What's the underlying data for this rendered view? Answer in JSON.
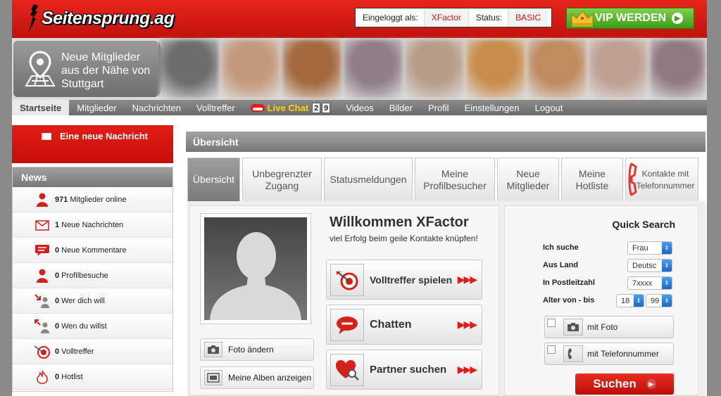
{
  "header": {
    "logo_text": "Seitensprung.ag",
    "logged_in_label": "Eingeloggt als:",
    "username": "XFactor",
    "status_label": "Status:",
    "status_value": "BASIC",
    "vip_button": "VIP WERDEN",
    "vip_arrow": "▶"
  },
  "banner": {
    "nearby_text": "Neue Mitglieder aus der Nähe von Stuttgart",
    "thumbs": [
      "#6d6d6d",
      "#c49a7e",
      "#a4693d",
      "#8f7d88",
      "#b89d89",
      "#c98c4b",
      "#c08b5e",
      "#bfa091",
      "#8e7a7f"
    ]
  },
  "nav": {
    "items": [
      "Startseite",
      "Mitglieder",
      "Nachrichten",
      "Volltreffer"
    ],
    "live_chat": "Live Chat",
    "live_digits": [
      "2",
      "9"
    ],
    "items_after": [
      "Videos",
      "Bilder",
      "Profil",
      "Einstellungen",
      "Logout"
    ]
  },
  "sidebar": {
    "new_message": "Eine neue Nachricht",
    "news_title": "News",
    "news": [
      {
        "count": "971",
        "label": "Mitglieder online"
      },
      {
        "count": "1",
        "label": "Neue Nachrichten"
      },
      {
        "count": "0",
        "label": "Neue Kommentare"
      },
      {
        "count": "0",
        "label": "Profilbesuche"
      },
      {
        "count": "0",
        "label": "Wer dich will"
      },
      {
        "count": "0",
        "label": "Wen du willst"
      },
      {
        "count": "0",
        "label": "Volltreffer"
      },
      {
        "count": "0",
        "label": "Hotlist"
      }
    ]
  },
  "main": {
    "title": "Übersicht",
    "tabs": [
      {
        "label": "Übersicht"
      },
      {
        "label": "Unbegrenzter Zugang"
      },
      {
        "label": "Statusmeldungen"
      },
      {
        "label": "Meine Profilbesucher"
      },
      {
        "label": "Neue Mitglieder"
      },
      {
        "label": "Meine Hotliste"
      },
      {
        "label": "Kontakte mit Telefonnummer"
      }
    ],
    "welcome": "Willkommen XFactor",
    "subtitle": "viel Erfolg beim geile Kontakte knüpfen!",
    "photo_change": "Foto ändern",
    "show_albums": "Meine Alben anzeigen",
    "actions": [
      {
        "label": "Volltreffer spielen"
      },
      {
        "label": "Chatten"
      },
      {
        "label": "Partner suchen"
      }
    ],
    "action_arrows": "▶▶▶"
  },
  "quick_search": {
    "title": "Quick Search",
    "fields": [
      {
        "label": "Ich suche",
        "value": "Frau"
      },
      {
        "label": "Aus Land",
        "value": "Deutsc"
      },
      {
        "label": "In Postleitzahl",
        "value": "7xxxx"
      },
      {
        "label": "Alter von - bis",
        "value_from": "18",
        "value_to": "99"
      }
    ],
    "with_photo": "mit Foto",
    "with_phone": "mit Telefonnummer",
    "search_button": "Suchen",
    "search_arrow": "▶"
  },
  "colors": {
    "brand_red": "#d8120c",
    "vip_green": "#3c9c16",
    "live_yellow": "#ffd200"
  }
}
